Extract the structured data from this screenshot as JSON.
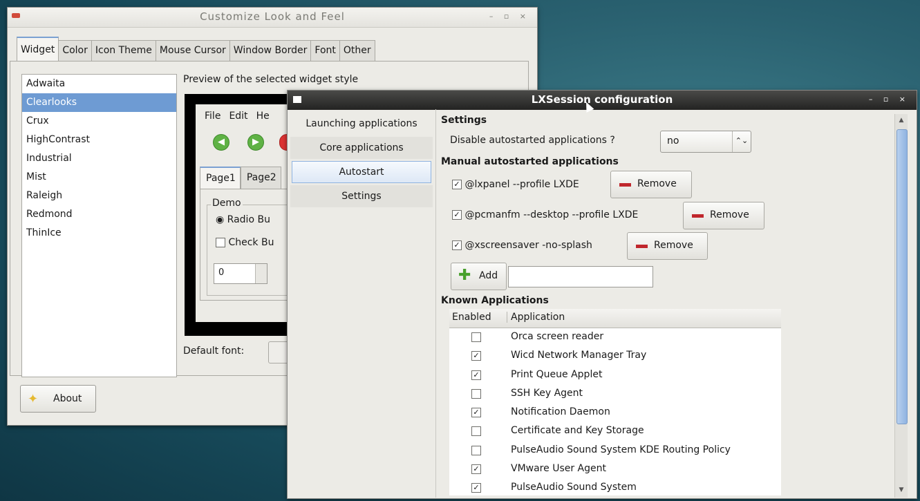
{
  "customize": {
    "title": "Customize Look and Feel",
    "window_controls": "– ▫ ×",
    "tabs": [
      "Widget",
      "Color",
      "Icon Theme",
      "Mouse Cursor",
      "Window Border",
      "Font",
      "Other"
    ],
    "themes": [
      "Adwaita",
      "Clearlooks",
      "Crux",
      "HighContrast",
      "Industrial",
      "Mist",
      "Raleigh",
      "Redmond",
      "ThinIce"
    ],
    "selected_theme": "Clearlooks",
    "preview_label": "Preview of the selected widget style",
    "preview": {
      "menu": [
        "File",
        "Edit",
        "He"
      ],
      "tabs": [
        "Page1",
        "Page2"
      ],
      "frame_label": "Demo",
      "radio_label": "Radio Bu",
      "check_label": "Check Bu",
      "spin_value": "0"
    },
    "default_font_label": "Default font:",
    "about_label": "About"
  },
  "lxsession": {
    "title": "LXSession configuration",
    "window_controls": "– ▫ ×",
    "sidebar": [
      "Launching applications",
      "Core applications",
      "Autostart",
      "Settings"
    ],
    "active_sidebar": "Autostart",
    "settings_heading": "Settings",
    "disable_label": "Disable autostarted applications ?",
    "disable_value": "no",
    "manual_heading": "Manual autostarted applications",
    "manual": [
      {
        "cmd": "@lxpanel --profile LXDE",
        "checked": true
      },
      {
        "cmd": "@pcmanfm --desktop --profile LXDE",
        "checked": true
      },
      {
        "cmd": "@xscreensaver -no-splash",
        "checked": true
      }
    ],
    "remove_label": "Remove",
    "add_label": "Add",
    "add_value": "",
    "known_heading": "Known Applications",
    "known_columns": [
      "Enabled",
      "Application"
    ],
    "known": [
      {
        "name": "Orca screen reader",
        "enabled": false
      },
      {
        "name": "Wicd Network Manager Tray",
        "enabled": true
      },
      {
        "name": "Print Queue Applet",
        "enabled": true
      },
      {
        "name": "SSH Key Agent",
        "enabled": false
      },
      {
        "name": "Notification Daemon",
        "enabled": true
      },
      {
        "name": "Certificate and Key Storage",
        "enabled": false
      },
      {
        "name": "PulseAudio Sound System KDE Routing Policy",
        "enabled": false
      },
      {
        "name": "VMware User Agent",
        "enabled": true
      },
      {
        "name": "PulseAudio Sound System",
        "enabled": true
      }
    ]
  },
  "colors": {
    "selection": "#6e9bd3",
    "remove_red": "#c0272d",
    "add_green": "#48a02c"
  }
}
